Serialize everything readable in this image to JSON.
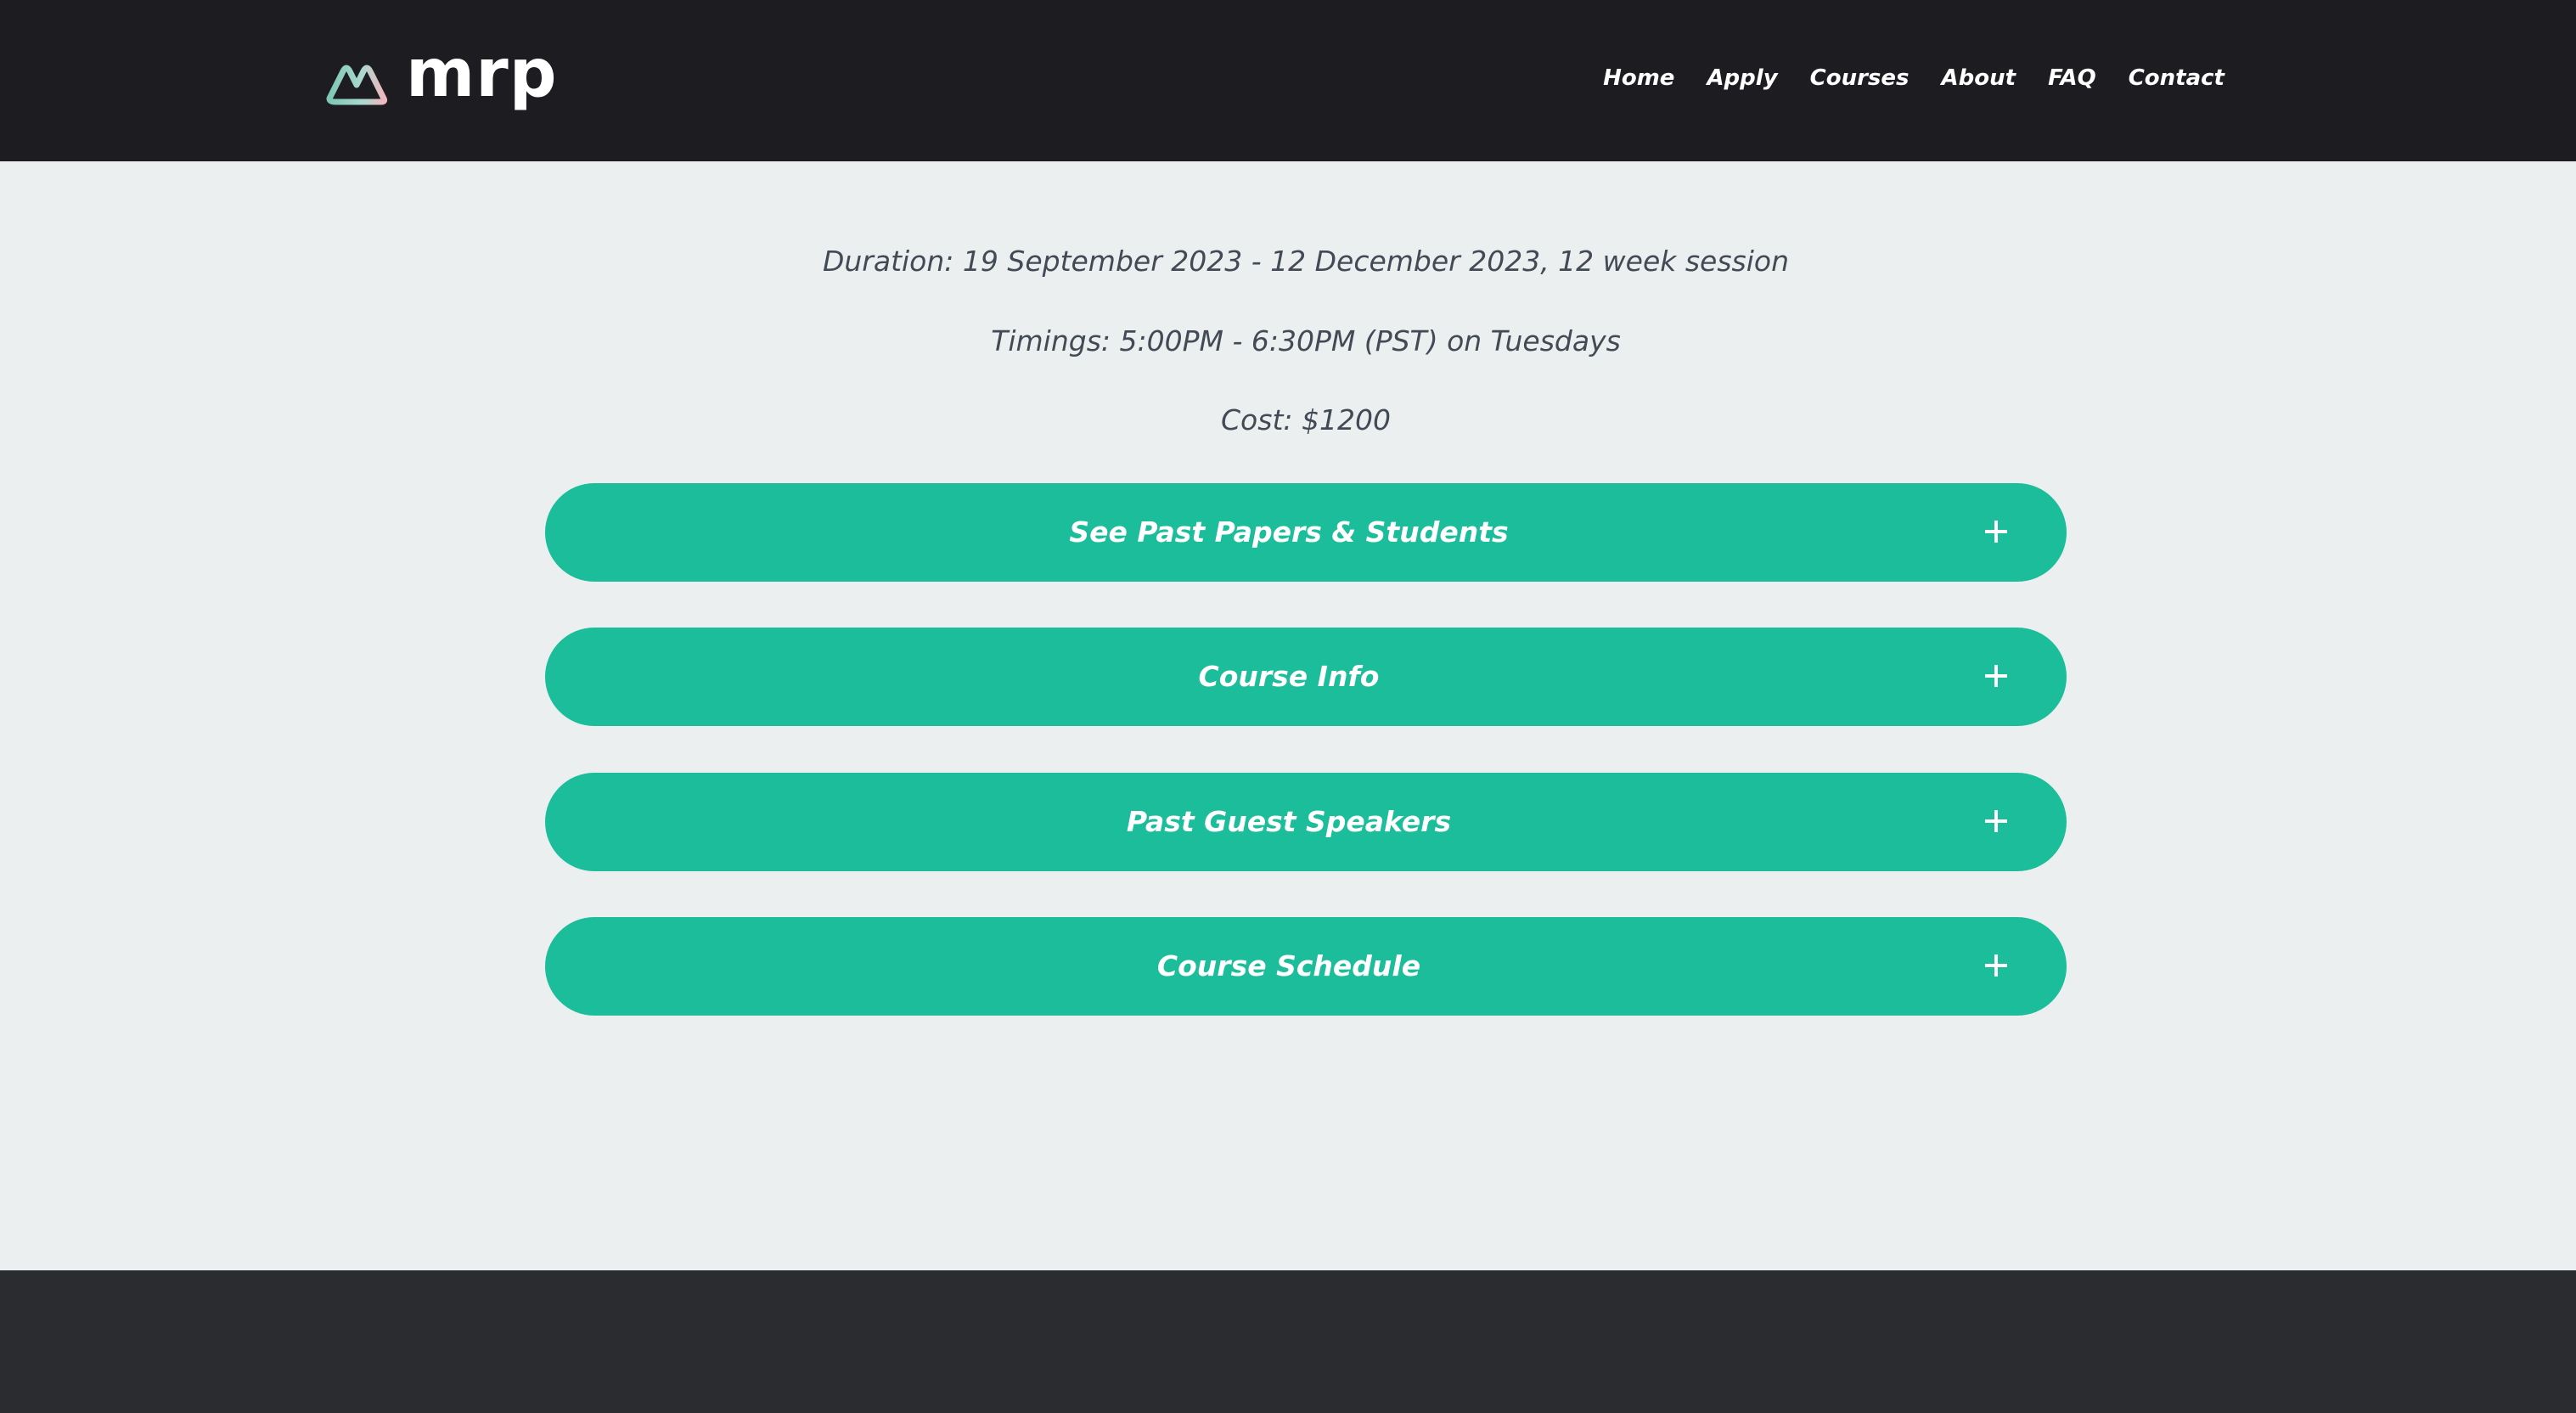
{
  "header": {
    "logo_text": "mrp",
    "logo_icon": "mountain-logo-icon",
    "nav": [
      {
        "label": "Home"
      },
      {
        "label": "Apply"
      },
      {
        "label": "Courses"
      },
      {
        "label": "About"
      },
      {
        "label": "FAQ"
      },
      {
        "label": "Contact"
      }
    ]
  },
  "course": {
    "duration": "Duration: 19 September 2023 - 12 December 2023, 12 week session",
    "timings": "Timings: 5:00PM - 6:30PM (PST) on Tuesdays",
    "cost": "Cost: $1200"
  },
  "accordions": [
    {
      "title": "See Past Papers & Students",
      "icon": "plus-icon"
    },
    {
      "title": "Course Info",
      "icon": "plus-icon"
    },
    {
      "title": "Past Guest Speakers",
      "icon": "plus-icon"
    },
    {
      "title": "Course Schedule",
      "icon": "plus-icon"
    }
  ],
  "colors": {
    "header_bg": "#1d1d21",
    "page_bg": "#eceff0",
    "accent": "#1cbd9b",
    "text": "#424a55",
    "footer_bg": "#2b2c30"
  }
}
